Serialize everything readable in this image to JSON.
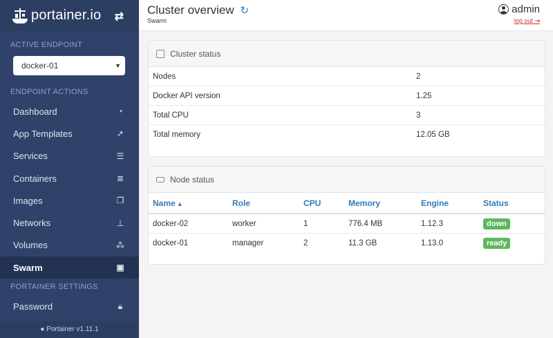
{
  "brand": {
    "name": "portainer.io"
  },
  "sidebar": {
    "active_endpoint_heading": "ACTIVE ENDPOINT",
    "endpoint_selected": "docker-01",
    "endpoint_actions_heading": "ENDPOINT ACTIONS",
    "items": [
      {
        "label": "Dashboard",
        "icon": "tachometer-icon"
      },
      {
        "label": "App Templates",
        "icon": "rocket-icon"
      },
      {
        "label": "Services",
        "icon": "list-alt-icon"
      },
      {
        "label": "Containers",
        "icon": "server-icon"
      },
      {
        "label": "Images",
        "icon": "clone-icon"
      },
      {
        "label": "Networks",
        "icon": "sitemap-icon"
      },
      {
        "label": "Volumes",
        "icon": "cubes-icon"
      },
      {
        "label": "Swarm",
        "icon": "object-group-icon"
      }
    ],
    "settings_heading": "PORTAINER SETTINGS",
    "password_label": "Password",
    "footer": "Portainer v1.11.1"
  },
  "header": {
    "title": "Cluster overview",
    "breadcrumb": "Swarm",
    "username": "admin",
    "logout": "log out"
  },
  "cluster_status": {
    "title": "Cluster status",
    "rows": [
      {
        "key": "Nodes",
        "value": "2"
      },
      {
        "key": "Docker API version",
        "value": "1.25"
      },
      {
        "key": "Total CPU",
        "value": "3"
      },
      {
        "key": "Total memory",
        "value": "12.05 GB"
      }
    ]
  },
  "node_status": {
    "title": "Node status",
    "columns": [
      "Name",
      "Role",
      "CPU",
      "Memory",
      "Engine",
      "Status"
    ],
    "rows": [
      {
        "name": "docker-02",
        "role": "worker",
        "cpu": "1",
        "memory": "776.4 MB",
        "engine": "1.12.3",
        "status": "down"
      },
      {
        "name": "docker-01",
        "role": "manager",
        "cpu": "2",
        "memory": "11.3 GB",
        "engine": "1.13.0",
        "status": "ready"
      }
    ]
  },
  "colors": {
    "sidebar_bg": "#30426a",
    "accent": "#337ab7",
    "status_badge": "#5cb85c",
    "logout": "#c9302c"
  }
}
